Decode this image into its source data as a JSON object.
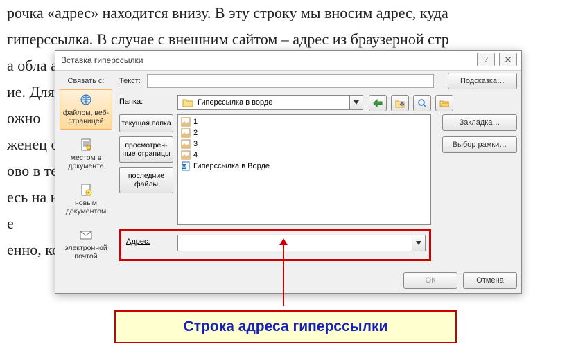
{
  "bg_lines": [
    "рочка «адрес» находится внизу. В эту строку мы вносим адрес, куда",
    "гиперссылка. В случае с внешним сайтом – адрес из браузерной стр",
    "а обла                                                                                                      а – то",
    "ие. Для                                                                                                   нам пр",
    "ожно",
    "",
    "женец                                                                                                   ой кно",
    "ово в те                                                                                                  ту же п",
    "есь на н",
    "",
    "е",
    "",
    "енно, коротко                                                                         де. Получайте уд"
  ],
  "dialog": {
    "title": "Вставка гиперссылки",
    "link_to_label": "Связать с:",
    "linkto": [
      {
        "label": "файлом, веб-страницей",
        "selected": true
      },
      {
        "label": "местом в документе",
        "selected": false
      },
      {
        "label": "новым документом",
        "selected": false
      },
      {
        "label": "электронной почтой",
        "selected": false
      }
    ],
    "text_label": "Текст:",
    "text_value": "",
    "tooltip_btn": "Подсказка…",
    "folder_label": "Папка:",
    "folder_value": "Гиперссылка в ворде",
    "subtabs": [
      "текущая папка",
      "просмотрен-ные страницы",
      "последние файлы"
    ],
    "files": [
      "1",
      "2",
      "3",
      "4",
      "Гиперссылка в Ворде"
    ],
    "bookmark_btn": "Закладка…",
    "frame_btn": "Выбор рамки…",
    "address_label": "Адрес:",
    "address_value": "",
    "ok": "ОК",
    "cancel": "Отмена"
  },
  "callout": "Строка адреса гиперссылки"
}
